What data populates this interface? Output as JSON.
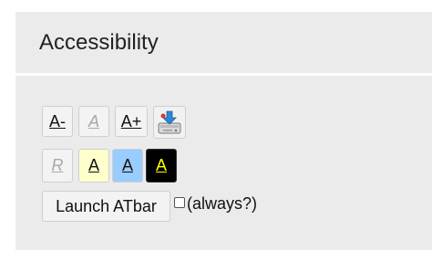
{
  "panel": {
    "title": "Accessibility"
  },
  "toolbar": {
    "decrease_font_label": "A-",
    "reset_font_label": "A",
    "increase_font_label": "A+",
    "save_icon": "hard-drive-save-icon",
    "reset_contrast_label": "R",
    "yellow_contrast_label": "A",
    "blue_contrast_label": "A",
    "black_contrast_label": "A",
    "launch_label": "Launch ATbar",
    "always_label": "(always?)",
    "always_checked": false
  },
  "colors": {
    "panel_bg": "#ebebeb",
    "yellow_contrast_bg": "#ffffcc",
    "blue_contrast_bg": "#99ccff",
    "black_contrast_bg": "#000000",
    "black_contrast_text": "#ffff00",
    "disabled_text": "#a8a8a8"
  }
}
